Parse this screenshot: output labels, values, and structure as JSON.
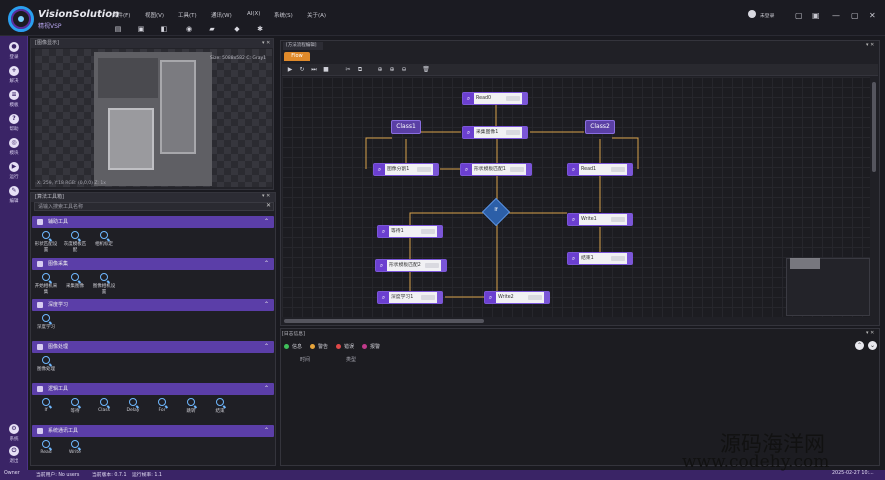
{
  "app": {
    "brand": "VisionSolution",
    "brand_sub": "精视VSP"
  },
  "menu": [
    "文件(F)",
    "视图(V)",
    "工具(T)",
    "通讯(W)",
    "AI(X)",
    "系统(S)",
    "关于(A)"
  ],
  "window": {
    "user_label": "未登录",
    "minimize": "—",
    "maximize": "▢",
    "close": "✕"
  },
  "rail": [
    "登录",
    "解决",
    "模板",
    "帮助",
    "模块",
    "运行",
    "编辑",
    "系统",
    "退出"
  ],
  "image_panel": {
    "title": "[图像显示]",
    "info": "Size: 5088x582 C: Gray1",
    "status": "X: 259, Y:18 RGB: (0,0,0) Z: 1x"
  },
  "tool_panel": {
    "title": "[算法工具箱]",
    "search_placeholder": "请输入搜索工具名称",
    "categories": [
      {
        "name": "辅助工具",
        "tools": [
          "形状匹配设置",
          "灰度模板匹配",
          "相机标定"
        ]
      },
      {
        "name": "图像采集",
        "tools": [
          "开始相机采集",
          "采集图像",
          "图像相机设置"
        ]
      },
      {
        "name": "深度学习",
        "tools": [
          "深度学习"
        ]
      },
      {
        "name": "图像处理",
        "tools": [
          "图像处理"
        ]
      },
      {
        "name": "逻辑工具",
        "tools": [
          "If",
          "等待",
          "Class",
          "Delay",
          "For",
          "跳转",
          "结束"
        ]
      },
      {
        "name": "系统通讯工具",
        "tools": [
          "Read",
          "Write"
        ]
      }
    ]
  },
  "flow": {
    "tab": "[方法流程编辑]",
    "active_tab": "Flow",
    "nodes": {
      "read0": "Read0",
      "acq1": "采集图像1",
      "class1": "Class1",
      "class2": "Class2",
      "seg1": "图像分割1",
      "shape1": "形状模板匹配1",
      "other1": "Read1",
      "wait1": "等待1",
      "shape2": "形状模板匹配2",
      "deep1": "深度学习1",
      "write1": "Write1",
      "write2": "Write2",
      "end1": "结束1",
      "if": "If"
    }
  },
  "log_panel": {
    "title": "[日志信息]",
    "filters": [
      "信息",
      "警告",
      "错误",
      "报警"
    ],
    "col_time": "时间",
    "col_type": "类型"
  },
  "statusbar": {
    "user": "Owner",
    "login": "当前用户: No users",
    "ver": "当前版本: 0.7.1",
    "fps": "运行帧率: 1.1",
    "time": "2025-02-27 10:..."
  },
  "watermark": {
    "line1": "源码海洋网",
    "line2": "www.codehy.com"
  },
  "colors": {
    "accent": "#6b3fd0",
    "rail": "#3a2466",
    "tab": "#e08a2a"
  }
}
